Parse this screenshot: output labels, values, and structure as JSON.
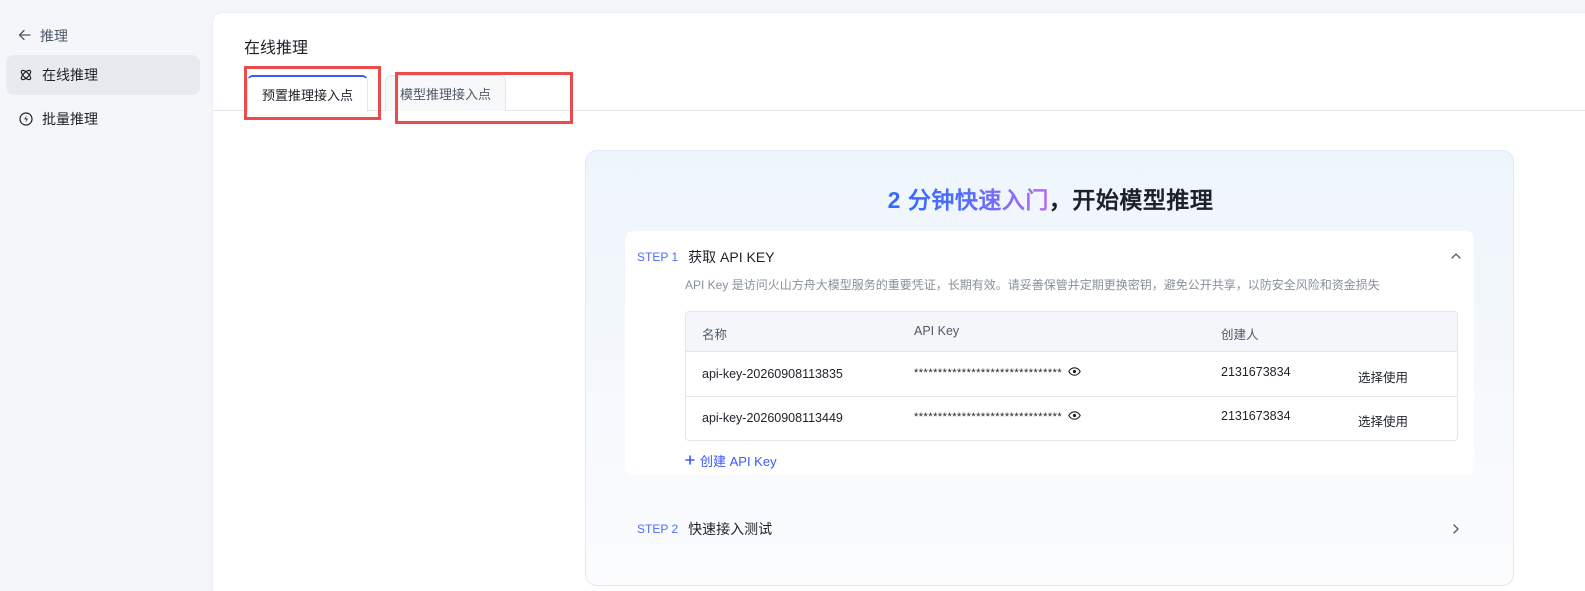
{
  "sidebar": {
    "back_label": "推理",
    "items": [
      {
        "label": "在线推理",
        "icon": "atom-icon",
        "active": true
      },
      {
        "label": "批量推理",
        "icon": "lightning-circle-icon",
        "active": false
      }
    ]
  },
  "main": {
    "title": "在线推理",
    "tabs": [
      {
        "label": "预置推理接入点",
        "active": true
      },
      {
        "label": "模型推理接入点",
        "active": false
      }
    ]
  },
  "guide": {
    "headline_highlight": "2 分钟快速入门",
    "headline_rest": "，开始模型推理",
    "step1": {
      "tag": "STEP 1",
      "title": "获取 API KEY",
      "description": "API Key 是访问火山方舟大模型服务的重要凭证，长期有效。请妥善保管并定期更换密钥，避免公开共享，以防安全风险和资金损失",
      "table": {
        "columns": [
          "名称",
          "API Key",
          "创建人"
        ],
        "rows": [
          {
            "name": "api-key-20260908113835",
            "key": "*******************************",
            "creator": "2131673834",
            "action": "选择使用"
          },
          {
            "name": "api-key-20260908113449",
            "key": "*******************************",
            "creator": "2131673834",
            "action": "选择使用"
          }
        ]
      },
      "create_label": "创建 API Key"
    },
    "step2": {
      "tag": "STEP 2",
      "title": "快速接入测试"
    }
  },
  "colors": {
    "accent": "#3b57ff",
    "highlight_box": "#ea4c4c",
    "gradient_start": "#2f6bff",
    "gradient_end": "#b86cf2"
  }
}
